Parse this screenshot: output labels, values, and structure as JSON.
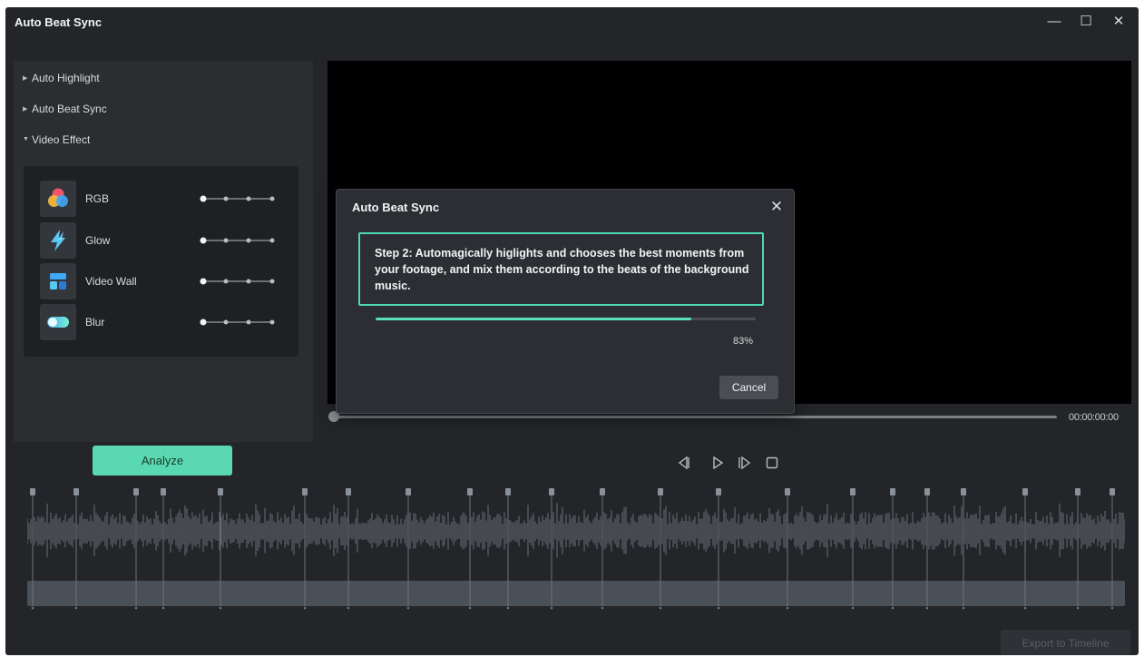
{
  "window": {
    "title": "Auto Beat Sync",
    "minimize_glyph": "—",
    "maximize_glyph": "☐",
    "close_glyph": "✕"
  },
  "left_panel": {
    "sections": [
      {
        "label": "Auto Highlight",
        "expanded": false
      },
      {
        "label": "Auto Beat Sync",
        "expanded": false
      },
      {
        "label": "Video Effect",
        "expanded": true
      }
    ],
    "effects": [
      {
        "name": "RGB",
        "icon": "rgb-circles-icon",
        "level": 0
      },
      {
        "name": "Glow",
        "icon": "lightning-icon",
        "level": 0
      },
      {
        "name": "Video Wall",
        "icon": "grid-tiles-icon",
        "level": 0
      },
      {
        "name": "Blur",
        "icon": "blur-toggle-icon",
        "level": 0
      }
    ]
  },
  "player": {
    "timecode": "00:00:00:00",
    "position": 0
  },
  "dialog": {
    "title": "Auto Beat Sync",
    "close_glyph": "✕",
    "step_text": "Step 2: Automagically higlights and chooses the best moments from your footage, and mix them according to the beats of the background music.",
    "progress": 0.83,
    "progress_label": "83%",
    "cancel_label": "Cancel"
  },
  "buttons": {
    "analyze_label": "Analyze",
    "export_label": "Export to Timeline"
  },
  "colors": {
    "accent": "#5ad9b0",
    "background": "#232528",
    "panel": "#2b2d31"
  }
}
